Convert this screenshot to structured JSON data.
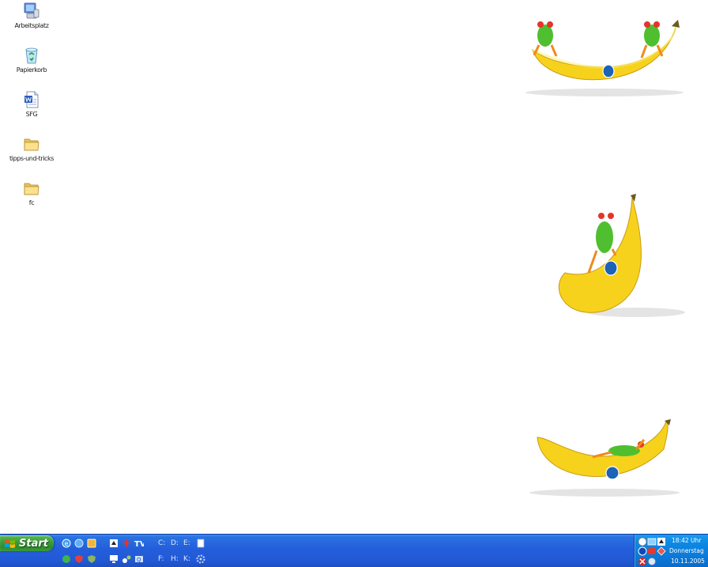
{
  "desktop": {
    "icons": [
      {
        "label": "Arbeitsplatz",
        "icon": "my-computer-icon"
      },
      {
        "label": "Papierkorb",
        "icon": "recycle-bin-icon"
      },
      {
        "label": "SFG",
        "icon": "word-document-icon"
      },
      {
        "label": "tipps-und-tricks",
        "icon": "folder-icon"
      },
      {
        "label": "fc",
        "icon": "folder-icon"
      }
    ]
  },
  "taskbar": {
    "start_label": "Start",
    "drives_row1": [
      "C:",
      "D:",
      "E:"
    ],
    "drives_row2": [
      "F:",
      "H:",
      "K:"
    ],
    "quick_launch": [
      "ie-icon",
      "ie-globe-icon",
      "outlook-icon",
      "app-icon",
      "bookmark-icon",
      "tv-icon",
      "network-icon",
      "shield-icon",
      "shield-icon",
      "monitor-icon",
      "tools-icon",
      "settings-icon"
    ]
  },
  "tray": {
    "time": "18:42 Uhr",
    "day": "Donnerstag",
    "date": "10.11.2005"
  },
  "colors": {
    "taskbar_blue": "#245edb",
    "start_green": "#3c9f3a",
    "tray_blue": "#0b77d6",
    "banana_yellow": "#f7d21c",
    "frog_green": "#4fbf2f"
  }
}
